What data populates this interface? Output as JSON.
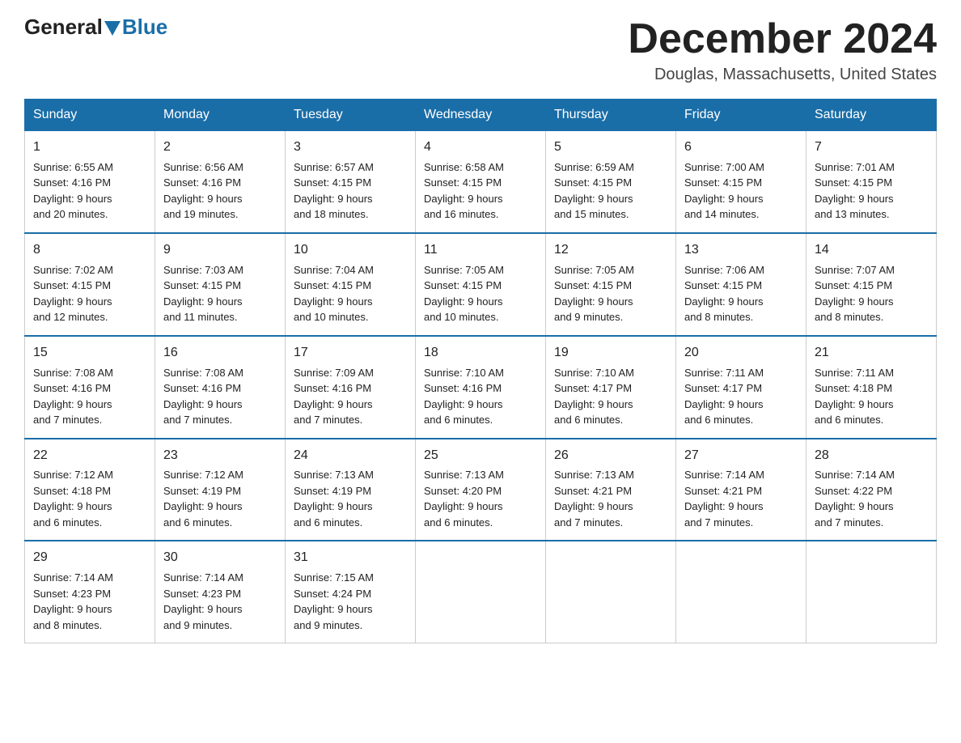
{
  "header": {
    "logo_general": "General",
    "logo_blue": "Blue",
    "month_title": "December 2024",
    "location": "Douglas, Massachusetts, United States"
  },
  "days_of_week": [
    "Sunday",
    "Monday",
    "Tuesday",
    "Wednesday",
    "Thursday",
    "Friday",
    "Saturday"
  ],
  "weeks": [
    [
      {
        "num": "1",
        "info": "Sunrise: 6:55 AM\nSunset: 4:16 PM\nDaylight: 9 hours\nand 20 minutes."
      },
      {
        "num": "2",
        "info": "Sunrise: 6:56 AM\nSunset: 4:16 PM\nDaylight: 9 hours\nand 19 minutes."
      },
      {
        "num": "3",
        "info": "Sunrise: 6:57 AM\nSunset: 4:15 PM\nDaylight: 9 hours\nand 18 minutes."
      },
      {
        "num": "4",
        "info": "Sunrise: 6:58 AM\nSunset: 4:15 PM\nDaylight: 9 hours\nand 16 minutes."
      },
      {
        "num": "5",
        "info": "Sunrise: 6:59 AM\nSunset: 4:15 PM\nDaylight: 9 hours\nand 15 minutes."
      },
      {
        "num": "6",
        "info": "Sunrise: 7:00 AM\nSunset: 4:15 PM\nDaylight: 9 hours\nand 14 minutes."
      },
      {
        "num": "7",
        "info": "Sunrise: 7:01 AM\nSunset: 4:15 PM\nDaylight: 9 hours\nand 13 minutes."
      }
    ],
    [
      {
        "num": "8",
        "info": "Sunrise: 7:02 AM\nSunset: 4:15 PM\nDaylight: 9 hours\nand 12 minutes."
      },
      {
        "num": "9",
        "info": "Sunrise: 7:03 AM\nSunset: 4:15 PM\nDaylight: 9 hours\nand 11 minutes."
      },
      {
        "num": "10",
        "info": "Sunrise: 7:04 AM\nSunset: 4:15 PM\nDaylight: 9 hours\nand 10 minutes."
      },
      {
        "num": "11",
        "info": "Sunrise: 7:05 AM\nSunset: 4:15 PM\nDaylight: 9 hours\nand 10 minutes."
      },
      {
        "num": "12",
        "info": "Sunrise: 7:05 AM\nSunset: 4:15 PM\nDaylight: 9 hours\nand 9 minutes."
      },
      {
        "num": "13",
        "info": "Sunrise: 7:06 AM\nSunset: 4:15 PM\nDaylight: 9 hours\nand 8 minutes."
      },
      {
        "num": "14",
        "info": "Sunrise: 7:07 AM\nSunset: 4:15 PM\nDaylight: 9 hours\nand 8 minutes."
      }
    ],
    [
      {
        "num": "15",
        "info": "Sunrise: 7:08 AM\nSunset: 4:16 PM\nDaylight: 9 hours\nand 7 minutes."
      },
      {
        "num": "16",
        "info": "Sunrise: 7:08 AM\nSunset: 4:16 PM\nDaylight: 9 hours\nand 7 minutes."
      },
      {
        "num": "17",
        "info": "Sunrise: 7:09 AM\nSunset: 4:16 PM\nDaylight: 9 hours\nand 7 minutes."
      },
      {
        "num": "18",
        "info": "Sunrise: 7:10 AM\nSunset: 4:16 PM\nDaylight: 9 hours\nand 6 minutes."
      },
      {
        "num": "19",
        "info": "Sunrise: 7:10 AM\nSunset: 4:17 PM\nDaylight: 9 hours\nand 6 minutes."
      },
      {
        "num": "20",
        "info": "Sunrise: 7:11 AM\nSunset: 4:17 PM\nDaylight: 9 hours\nand 6 minutes."
      },
      {
        "num": "21",
        "info": "Sunrise: 7:11 AM\nSunset: 4:18 PM\nDaylight: 9 hours\nand 6 minutes."
      }
    ],
    [
      {
        "num": "22",
        "info": "Sunrise: 7:12 AM\nSunset: 4:18 PM\nDaylight: 9 hours\nand 6 minutes."
      },
      {
        "num": "23",
        "info": "Sunrise: 7:12 AM\nSunset: 4:19 PM\nDaylight: 9 hours\nand 6 minutes."
      },
      {
        "num": "24",
        "info": "Sunrise: 7:13 AM\nSunset: 4:19 PM\nDaylight: 9 hours\nand 6 minutes."
      },
      {
        "num": "25",
        "info": "Sunrise: 7:13 AM\nSunset: 4:20 PM\nDaylight: 9 hours\nand 6 minutes."
      },
      {
        "num": "26",
        "info": "Sunrise: 7:13 AM\nSunset: 4:21 PM\nDaylight: 9 hours\nand 7 minutes."
      },
      {
        "num": "27",
        "info": "Sunrise: 7:14 AM\nSunset: 4:21 PM\nDaylight: 9 hours\nand 7 minutes."
      },
      {
        "num": "28",
        "info": "Sunrise: 7:14 AM\nSunset: 4:22 PM\nDaylight: 9 hours\nand 7 minutes."
      }
    ],
    [
      {
        "num": "29",
        "info": "Sunrise: 7:14 AM\nSunset: 4:23 PM\nDaylight: 9 hours\nand 8 minutes."
      },
      {
        "num": "30",
        "info": "Sunrise: 7:14 AM\nSunset: 4:23 PM\nDaylight: 9 hours\nand 9 minutes."
      },
      {
        "num": "31",
        "info": "Sunrise: 7:15 AM\nSunset: 4:24 PM\nDaylight: 9 hours\nand 9 minutes."
      },
      null,
      null,
      null,
      null
    ]
  ]
}
